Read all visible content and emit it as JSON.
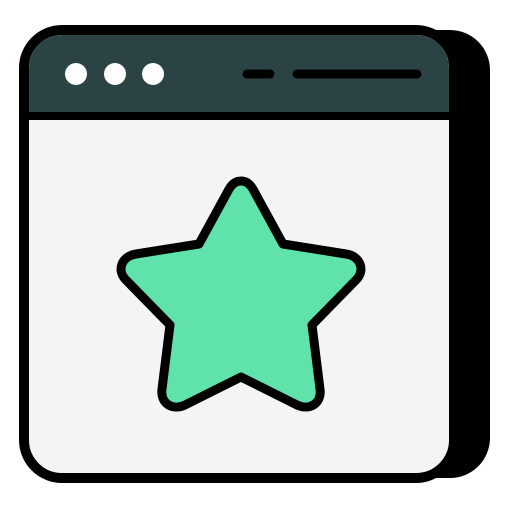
{
  "icon": {
    "name": "browser-window-favorite-star-icon",
    "window_type": "browser-window",
    "center_glyph": "star-icon",
    "titlebar_controls": [
      "dot-icon",
      "dot-icon",
      "dot-icon"
    ],
    "titlebar_address_lines": [
      "short-line-icon",
      "long-line-icon"
    ]
  },
  "colors": {
    "outline": "#000000",
    "titlebar": "#2c4346",
    "window_fill": "#f4f4f4",
    "shadow": "#000000",
    "star_fill": "#5fe3ab",
    "dots": "#ffffff",
    "address_lines": "#000000"
  }
}
